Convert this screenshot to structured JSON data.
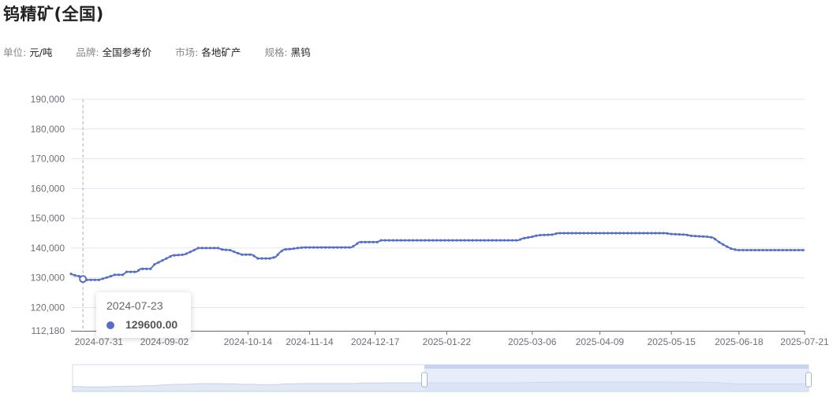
{
  "page": {
    "title": "钨精矿(全国)",
    "meta": [
      {
        "label": "单位:",
        "value": "元/吨"
      },
      {
        "label": "品牌:",
        "value": "全国参考价"
      },
      {
        "label": "市场:",
        "value": "各地矿产"
      },
      {
        "label": "规格:",
        "value": "黑钨"
      }
    ]
  },
  "tooltip": {
    "date": "2024-07-23",
    "value": "129600.00"
  },
  "colors": {
    "line": "#5470c6",
    "grid": "#e0e6f1",
    "zoom_fill": "#d5dff7"
  },
  "chart_data": {
    "type": "line",
    "title": "",
    "xlabel": "",
    "ylabel": "",
    "ylim": [
      112180,
      190000
    ],
    "y_ticks": [
      112180,
      120000,
      130000,
      140000,
      150000,
      160000,
      170000,
      180000,
      190000
    ],
    "y_tick_labels": [
      "112,180",
      "120,000",
      "130,000",
      "140,000",
      "150,000",
      "160,000",
      "170,000",
      "180,000",
      "190,000"
    ],
    "x_ticks": [
      "2024-07-31",
      "2024-09-02",
      "2024-10-14",
      "2024-11-14",
      "2024-12-17",
      "2025-01-22",
      "2025-03-06",
      "2025-04-09",
      "2025-05-15",
      "2025-06-18",
      "2025-07-21"
    ],
    "x_range": [
      "2024-07-17",
      "2025-07-21"
    ],
    "grid": true,
    "series": [
      {
        "points": [
          [
            "2024-07-17",
            131300
          ],
          [
            "2024-07-19",
            130800
          ],
          [
            "2024-07-22",
            130400
          ],
          [
            "2024-07-23",
            129600
          ],
          [
            "2024-07-25",
            129300
          ],
          [
            "2024-07-31",
            129300
          ],
          [
            "2024-08-05",
            130300
          ],
          [
            "2024-08-08",
            131000
          ],
          [
            "2024-08-12",
            131000
          ],
          [
            "2024-08-14",
            132000
          ],
          [
            "2024-08-19",
            132000
          ],
          [
            "2024-08-21",
            133000
          ],
          [
            "2024-08-26",
            133000
          ],
          [
            "2024-08-28",
            134500
          ],
          [
            "2024-08-31",
            135500
          ],
          [
            "2024-09-03",
            136500
          ],
          [
            "2024-09-06",
            137500
          ],
          [
            "2024-09-12",
            137800
          ],
          [
            "2024-09-16",
            139000
          ],
          [
            "2024-09-19",
            140000
          ],
          [
            "2024-09-29",
            140000
          ],
          [
            "2024-10-01",
            139500
          ],
          [
            "2024-10-05",
            139300
          ],
          [
            "2024-10-08",
            138500
          ],
          [
            "2024-10-11",
            137800
          ],
          [
            "2024-10-16",
            137800
          ],
          [
            "2024-10-19",
            136500
          ],
          [
            "2024-10-25",
            136500
          ],
          [
            "2024-10-28",
            137000
          ],
          [
            "2024-10-30",
            138500
          ],
          [
            "2024-11-01",
            139500
          ],
          [
            "2024-11-05",
            139700
          ],
          [
            "2024-11-08",
            140000
          ],
          [
            "2024-11-11",
            140200
          ],
          [
            "2024-12-05",
            140200
          ],
          [
            "2024-12-07",
            141000
          ],
          [
            "2024-12-09",
            142000
          ],
          [
            "2024-12-18",
            142000
          ],
          [
            "2024-12-20",
            142600
          ],
          [
            "2025-02-27",
            142600
          ],
          [
            "2025-03-01",
            143200
          ],
          [
            "2025-03-06",
            143800
          ],
          [
            "2025-03-09",
            144300
          ],
          [
            "2025-03-16",
            144500
          ],
          [
            "2025-03-19",
            145000
          ],
          [
            "2025-05-12",
            145000
          ],
          [
            "2025-05-15",
            144700
          ],
          [
            "2025-05-22",
            144500
          ],
          [
            "2025-05-25",
            144100
          ],
          [
            "2025-06-02",
            143800
          ],
          [
            "2025-06-05",
            143500
          ],
          [
            "2025-06-08",
            142000
          ],
          [
            "2025-06-11",
            140800
          ],
          [
            "2025-06-14",
            139800
          ],
          [
            "2025-06-17",
            139300
          ],
          [
            "2025-07-21",
            139300
          ]
        ]
      }
    ]
  }
}
